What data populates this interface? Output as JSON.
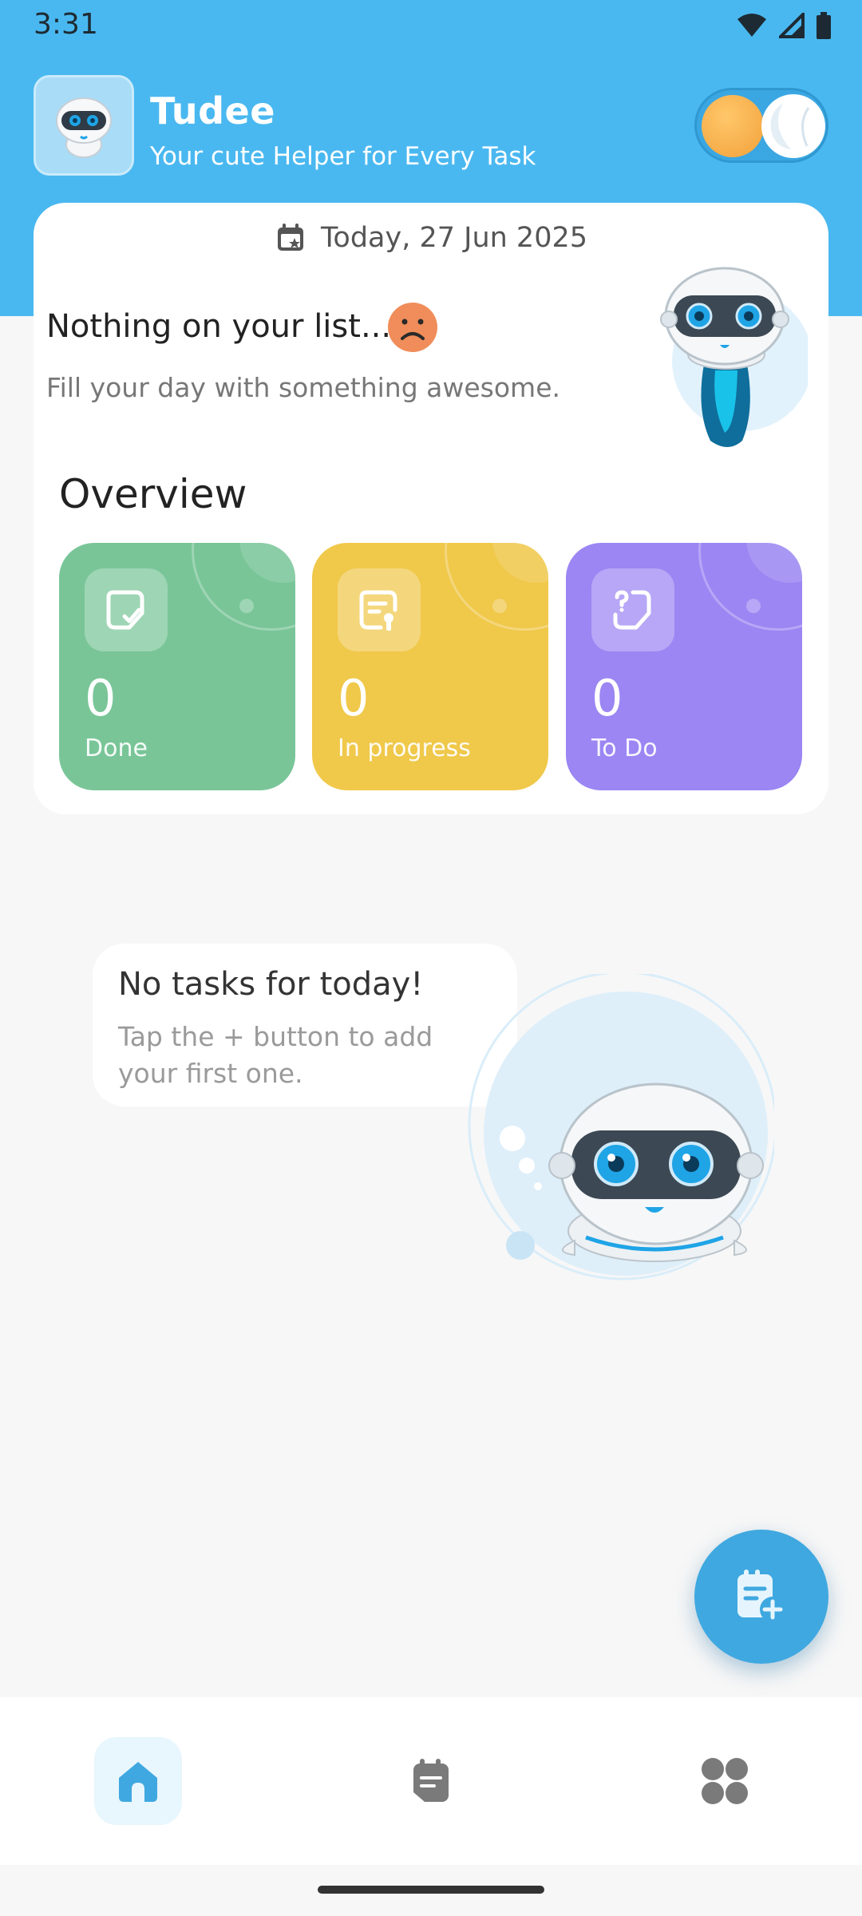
{
  "status_bar": {
    "time": "3:31",
    "icons": [
      "wifi-icon",
      "cell-signal-icon",
      "battery-icon"
    ]
  },
  "header": {
    "logo": "robot-logo-icon",
    "title": "Tudee",
    "subtitle": "Your cute Helper for Every Task",
    "theme_toggle": {
      "state": "light",
      "icons": [
        "sun-icon",
        "moon-icon"
      ]
    }
  },
  "summary_card": {
    "date_icon": "calendar-icon",
    "date": "Today, 27 Jun 2025",
    "empty_title": "Nothing on your list...",
    "empty_icon": "sad-face-icon",
    "empty_subtitle": "Fill your day with something awesome.",
    "overview_title": "Overview",
    "stats": [
      {
        "count": "0",
        "label": "Done",
        "icon": "done-note-icon",
        "color": "#79c598"
      },
      {
        "count": "0",
        "label": "In progress",
        "icon": "in-progress-note-icon",
        "color": "#f0c84a"
      },
      {
        "count": "0",
        "label": "To Do",
        "icon": "todo-note-icon",
        "color": "#9b86f3"
      }
    ]
  },
  "empty_state": {
    "title": "No tasks for today!",
    "subtitle": "Tap the + button to add your first one."
  },
  "fab": {
    "icon": "add-task-icon"
  },
  "bottom_nav": {
    "items": [
      {
        "id": "home",
        "icon": "home-icon",
        "active": true
      },
      {
        "id": "tasks",
        "icon": "tasks-icon",
        "active": false
      },
      {
        "id": "categories",
        "icon": "categories-icon",
        "active": false
      }
    ]
  },
  "colors": {
    "primary": "#4ab8f0",
    "fab": "#3fa8e0",
    "background": "#f7f7f7",
    "done": "#79c598",
    "in_progress": "#f0c84a",
    "todo": "#9b86f3",
    "sad": "#f08d5a"
  }
}
